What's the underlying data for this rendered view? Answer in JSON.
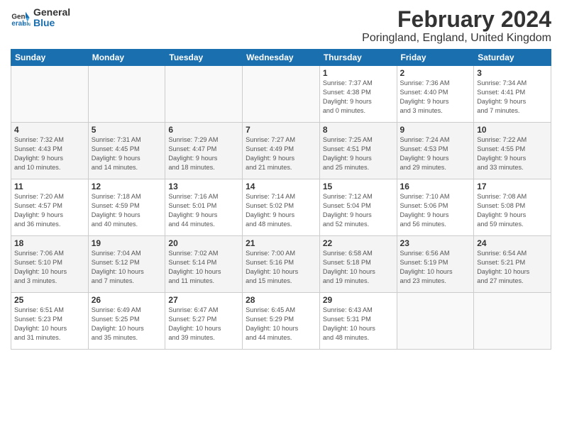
{
  "logo": {
    "line1": "General",
    "line2": "Blue"
  },
  "title": "February 2024",
  "subtitle": "Poringland, England, United Kingdom",
  "days_of_week": [
    "Sunday",
    "Monday",
    "Tuesday",
    "Wednesday",
    "Thursday",
    "Friday",
    "Saturday"
  ],
  "weeks": [
    [
      {
        "day": "",
        "info": ""
      },
      {
        "day": "",
        "info": ""
      },
      {
        "day": "",
        "info": ""
      },
      {
        "day": "",
        "info": ""
      },
      {
        "day": "1",
        "info": "Sunrise: 7:37 AM\nSunset: 4:38 PM\nDaylight: 9 hours\nand 0 minutes."
      },
      {
        "day": "2",
        "info": "Sunrise: 7:36 AM\nSunset: 4:40 PM\nDaylight: 9 hours\nand 3 minutes."
      },
      {
        "day": "3",
        "info": "Sunrise: 7:34 AM\nSunset: 4:41 PM\nDaylight: 9 hours\nand 7 minutes."
      }
    ],
    [
      {
        "day": "4",
        "info": "Sunrise: 7:32 AM\nSunset: 4:43 PM\nDaylight: 9 hours\nand 10 minutes."
      },
      {
        "day": "5",
        "info": "Sunrise: 7:31 AM\nSunset: 4:45 PM\nDaylight: 9 hours\nand 14 minutes."
      },
      {
        "day": "6",
        "info": "Sunrise: 7:29 AM\nSunset: 4:47 PM\nDaylight: 9 hours\nand 18 minutes."
      },
      {
        "day": "7",
        "info": "Sunrise: 7:27 AM\nSunset: 4:49 PM\nDaylight: 9 hours\nand 21 minutes."
      },
      {
        "day": "8",
        "info": "Sunrise: 7:25 AM\nSunset: 4:51 PM\nDaylight: 9 hours\nand 25 minutes."
      },
      {
        "day": "9",
        "info": "Sunrise: 7:24 AM\nSunset: 4:53 PM\nDaylight: 9 hours\nand 29 minutes."
      },
      {
        "day": "10",
        "info": "Sunrise: 7:22 AM\nSunset: 4:55 PM\nDaylight: 9 hours\nand 33 minutes."
      }
    ],
    [
      {
        "day": "11",
        "info": "Sunrise: 7:20 AM\nSunset: 4:57 PM\nDaylight: 9 hours\nand 36 minutes."
      },
      {
        "day": "12",
        "info": "Sunrise: 7:18 AM\nSunset: 4:59 PM\nDaylight: 9 hours\nand 40 minutes."
      },
      {
        "day": "13",
        "info": "Sunrise: 7:16 AM\nSunset: 5:01 PM\nDaylight: 9 hours\nand 44 minutes."
      },
      {
        "day": "14",
        "info": "Sunrise: 7:14 AM\nSunset: 5:02 PM\nDaylight: 9 hours\nand 48 minutes."
      },
      {
        "day": "15",
        "info": "Sunrise: 7:12 AM\nSunset: 5:04 PM\nDaylight: 9 hours\nand 52 minutes."
      },
      {
        "day": "16",
        "info": "Sunrise: 7:10 AM\nSunset: 5:06 PM\nDaylight: 9 hours\nand 56 minutes."
      },
      {
        "day": "17",
        "info": "Sunrise: 7:08 AM\nSunset: 5:08 PM\nDaylight: 9 hours\nand 59 minutes."
      }
    ],
    [
      {
        "day": "18",
        "info": "Sunrise: 7:06 AM\nSunset: 5:10 PM\nDaylight: 10 hours\nand 3 minutes."
      },
      {
        "day": "19",
        "info": "Sunrise: 7:04 AM\nSunset: 5:12 PM\nDaylight: 10 hours\nand 7 minutes."
      },
      {
        "day": "20",
        "info": "Sunrise: 7:02 AM\nSunset: 5:14 PM\nDaylight: 10 hours\nand 11 minutes."
      },
      {
        "day": "21",
        "info": "Sunrise: 7:00 AM\nSunset: 5:16 PM\nDaylight: 10 hours\nand 15 minutes."
      },
      {
        "day": "22",
        "info": "Sunrise: 6:58 AM\nSunset: 5:18 PM\nDaylight: 10 hours\nand 19 minutes."
      },
      {
        "day": "23",
        "info": "Sunrise: 6:56 AM\nSunset: 5:19 PM\nDaylight: 10 hours\nand 23 minutes."
      },
      {
        "day": "24",
        "info": "Sunrise: 6:54 AM\nSunset: 5:21 PM\nDaylight: 10 hours\nand 27 minutes."
      }
    ],
    [
      {
        "day": "25",
        "info": "Sunrise: 6:51 AM\nSunset: 5:23 PM\nDaylight: 10 hours\nand 31 minutes."
      },
      {
        "day": "26",
        "info": "Sunrise: 6:49 AM\nSunset: 5:25 PM\nDaylight: 10 hours\nand 35 minutes."
      },
      {
        "day": "27",
        "info": "Sunrise: 6:47 AM\nSunset: 5:27 PM\nDaylight: 10 hours\nand 39 minutes."
      },
      {
        "day": "28",
        "info": "Sunrise: 6:45 AM\nSunset: 5:29 PM\nDaylight: 10 hours\nand 44 minutes."
      },
      {
        "day": "29",
        "info": "Sunrise: 6:43 AM\nSunset: 5:31 PM\nDaylight: 10 hours\nand 48 minutes."
      },
      {
        "day": "",
        "info": ""
      },
      {
        "day": "",
        "info": ""
      }
    ]
  ]
}
